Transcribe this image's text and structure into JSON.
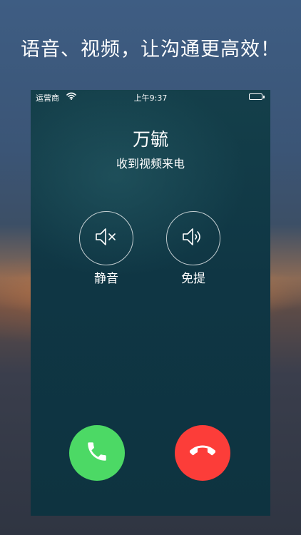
{
  "promo": {
    "headline": "语音、视频，让沟通更高效！"
  },
  "status_bar": {
    "carrier": "运营商",
    "time": "上午9:37",
    "battery_level": 1.0
  },
  "call": {
    "caller_name": "万毓",
    "status": "收到视频来电"
  },
  "controls": {
    "mute_label": "静音",
    "speaker_label": "免提"
  },
  "colors": {
    "answer": "#4cd965",
    "decline": "#fc3d39",
    "screen": "#0f3644"
  },
  "icons": {
    "wifi": "wifi-icon",
    "battery": "battery-icon",
    "mute": "speaker-mute-icon",
    "speaker": "speaker-on-icon",
    "answer": "phone-icon",
    "decline": "phone-hangup-icon"
  }
}
